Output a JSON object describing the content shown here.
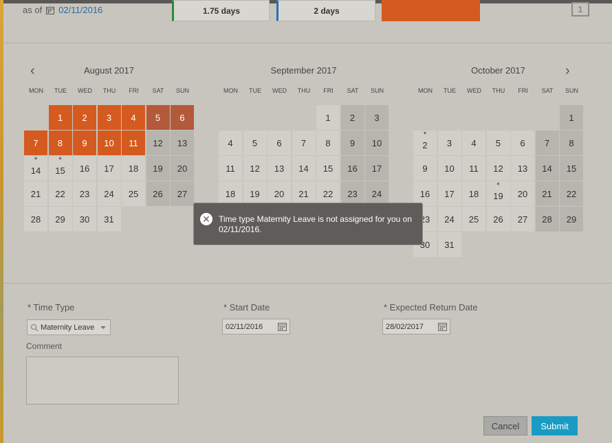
{
  "header": {
    "as_of_label": "as of",
    "as_of_date": "02/11/2016",
    "balances": [
      "1.75 days",
      "2 days"
    ],
    "icon_label": "1"
  },
  "weekday_headers": [
    "MON",
    "TUE",
    "WED",
    "THU",
    "FRI",
    "SAT",
    "SUN"
  ],
  "months": [
    {
      "title": "August 2017",
      "offset": 1,
      "days": 31,
      "holidays": [
        1,
        2,
        3,
        4,
        5,
        6,
        7,
        8,
        9,
        10,
        11
      ],
      "starred": [
        14,
        15
      ]
    },
    {
      "title": "September 2017",
      "offset": 4,
      "days": 30,
      "holidays": [],
      "starred": []
    },
    {
      "title": "October 2017",
      "offset": 6,
      "days": 31,
      "holidays": [],
      "starred": [
        2,
        19
      ]
    }
  ],
  "toast": {
    "message": "Time type Maternity Leave is not assigned for you on 02/11/2016."
  },
  "form": {
    "time_type_label": "* Time Type",
    "time_type_value": "Maternity Leave",
    "start_date_label": "* Start Date",
    "start_date_value": "02/11/2016",
    "return_date_label": "* Expected Return Date",
    "return_date_value": "28/02/2017",
    "comment_label": "Comment"
  },
  "buttons": {
    "cancel": "Cancel",
    "submit": "Submit"
  },
  "colors": {
    "holiday": "#d55a1f",
    "submit": "#1a9bc3"
  }
}
